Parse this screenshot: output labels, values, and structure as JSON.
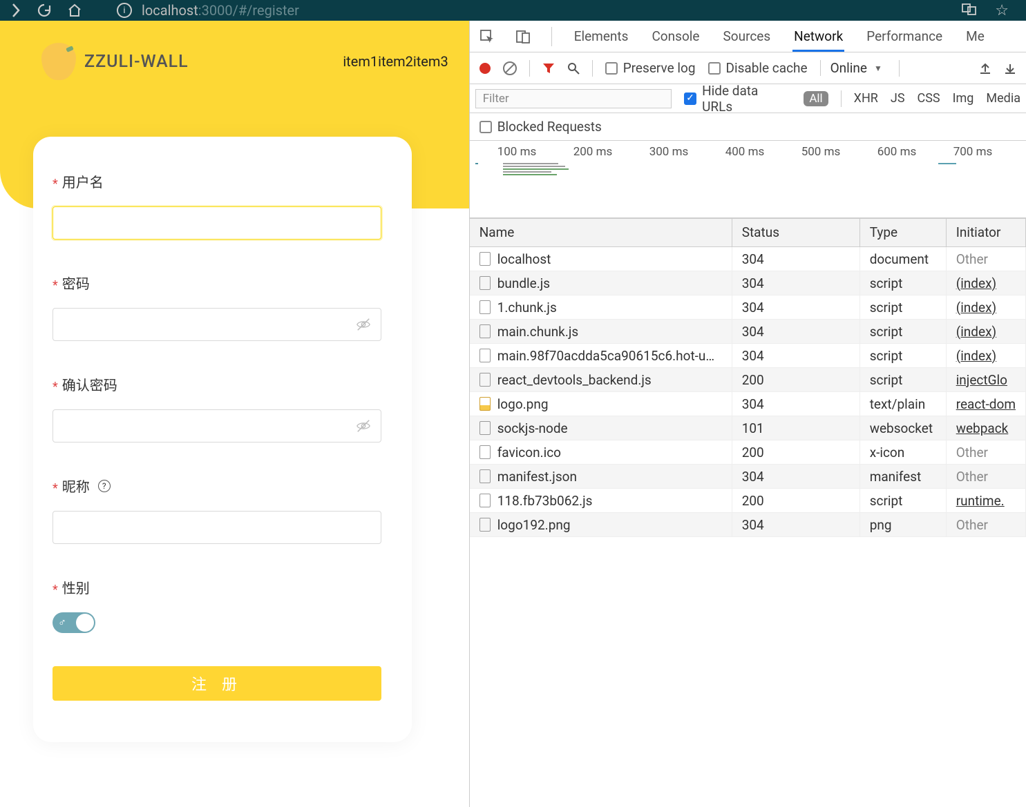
{
  "browser": {
    "url_host": "localhost",
    "url_rest": ":3000/#/register"
  },
  "page": {
    "app_title": "ZZULI-WALL",
    "nav": "item1item2item3",
    "fields": {
      "username": "用户名",
      "password": "密码",
      "confirm": "确认密码",
      "nickname": "昵称",
      "gender": "性别"
    },
    "submit": "注 册"
  },
  "devtools": {
    "tabs": {
      "elements": "Elements",
      "console": "Console",
      "sources": "Sources",
      "network": "Network",
      "performance": "Performance",
      "more": "Me"
    },
    "toolbar": {
      "preserve_log": "Preserve log",
      "disable_cache": "Disable cache",
      "throttle": "Online"
    },
    "filter": {
      "placeholder": "Filter",
      "hide_data_urls": "Hide data URLs",
      "all": "All",
      "xhr": "XHR",
      "js": "JS",
      "css": "CSS",
      "img": "Img",
      "media": "Media"
    },
    "blocked_requests": "Blocked Requests",
    "timeline_ticks": [
      "100 ms",
      "200 ms",
      "300 ms",
      "400 ms",
      "500 ms",
      "600 ms",
      "700 ms"
    ],
    "columns": {
      "name": "Name",
      "status": "Status",
      "type": "Type",
      "initiator": "Initiator"
    },
    "rows": [
      {
        "name": "localhost",
        "status": "304",
        "type": "document",
        "initiator": "Other",
        "link": false,
        "icon": "doc"
      },
      {
        "name": "bundle.js",
        "status": "304",
        "type": "script",
        "initiator": "(index)",
        "link": true,
        "icon": "doc"
      },
      {
        "name": "1.chunk.js",
        "status": "304",
        "type": "script",
        "initiator": "(index)",
        "link": true,
        "icon": "doc"
      },
      {
        "name": "main.chunk.js",
        "status": "304",
        "type": "script",
        "initiator": "(index)",
        "link": true,
        "icon": "doc"
      },
      {
        "name": "main.98f70acdda5ca90615c6.hot-u…",
        "status": "304",
        "type": "script",
        "initiator": "(index)",
        "link": true,
        "icon": "doc"
      },
      {
        "name": "react_devtools_backend.js",
        "status": "200",
        "type": "script",
        "initiator": "injectGlo",
        "link": true,
        "icon": "doc"
      },
      {
        "name": "logo.png",
        "status": "304",
        "type": "text/plain",
        "initiator": "react-dom",
        "link": true,
        "icon": "img"
      },
      {
        "name": "sockjs-node",
        "status": "101",
        "type": "websocket",
        "initiator": "webpack",
        "link": true,
        "icon": "doc"
      },
      {
        "name": "favicon.ico",
        "status": "200",
        "type": "x-icon",
        "initiator": "Other",
        "link": false,
        "icon": "doc"
      },
      {
        "name": "manifest.json",
        "status": "304",
        "type": "manifest",
        "initiator": "Other",
        "link": false,
        "icon": "doc"
      },
      {
        "name": "118.fb73b062.js",
        "status": "200",
        "type": "script",
        "initiator": "runtime.",
        "link": true,
        "icon": "doc"
      },
      {
        "name": "logo192.png",
        "status": "304",
        "type": "png",
        "initiator": "Other",
        "link": false,
        "icon": "doc"
      }
    ]
  }
}
